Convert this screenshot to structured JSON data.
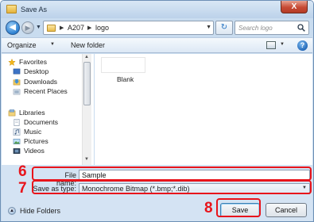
{
  "window": {
    "title": "Save As",
    "close_glyph": "X"
  },
  "address": {
    "crumbs": [
      "A207",
      "logo"
    ],
    "separator": "▶"
  },
  "search": {
    "placeholder": "Search logo"
  },
  "toolbar": {
    "organize_label": "Organize",
    "new_folder_label": "New folder"
  },
  "sidebar": {
    "items": [
      {
        "label": "Favorites",
        "icon": "star-icon"
      },
      {
        "label": "Desktop",
        "icon": "desktop-icon"
      },
      {
        "label": "Downloads",
        "icon": "downloads-icon"
      },
      {
        "label": "Recent Places",
        "icon": "recent-places-icon"
      },
      {
        "label": "Libraries",
        "icon": "libraries-icon"
      },
      {
        "label": "Documents",
        "icon": "documents-icon"
      },
      {
        "label": "Music",
        "icon": "music-icon"
      },
      {
        "label": "Pictures",
        "icon": "pictures-icon"
      },
      {
        "label": "Videos",
        "icon": "videos-icon"
      }
    ]
  },
  "files": [
    {
      "name": "Blank"
    }
  ],
  "form": {
    "file_name_label": "File name:",
    "file_name_value": "Sample",
    "save_type_label": "Save as type:",
    "save_type_value": "Monochrome Bitmap (*.bmp;*.dib)"
  },
  "footer": {
    "hide_folders_label": "Hide Folders"
  },
  "buttons": {
    "save_label": "Save",
    "cancel_label": "Cancel"
  },
  "annotations": {
    "file_name_step": "6",
    "save_type_step": "7",
    "save_button_step": "8"
  },
  "colors": {
    "annotation": "#e8141b",
    "title_bar": "#c9dcef",
    "close_button": "#c74a34"
  }
}
